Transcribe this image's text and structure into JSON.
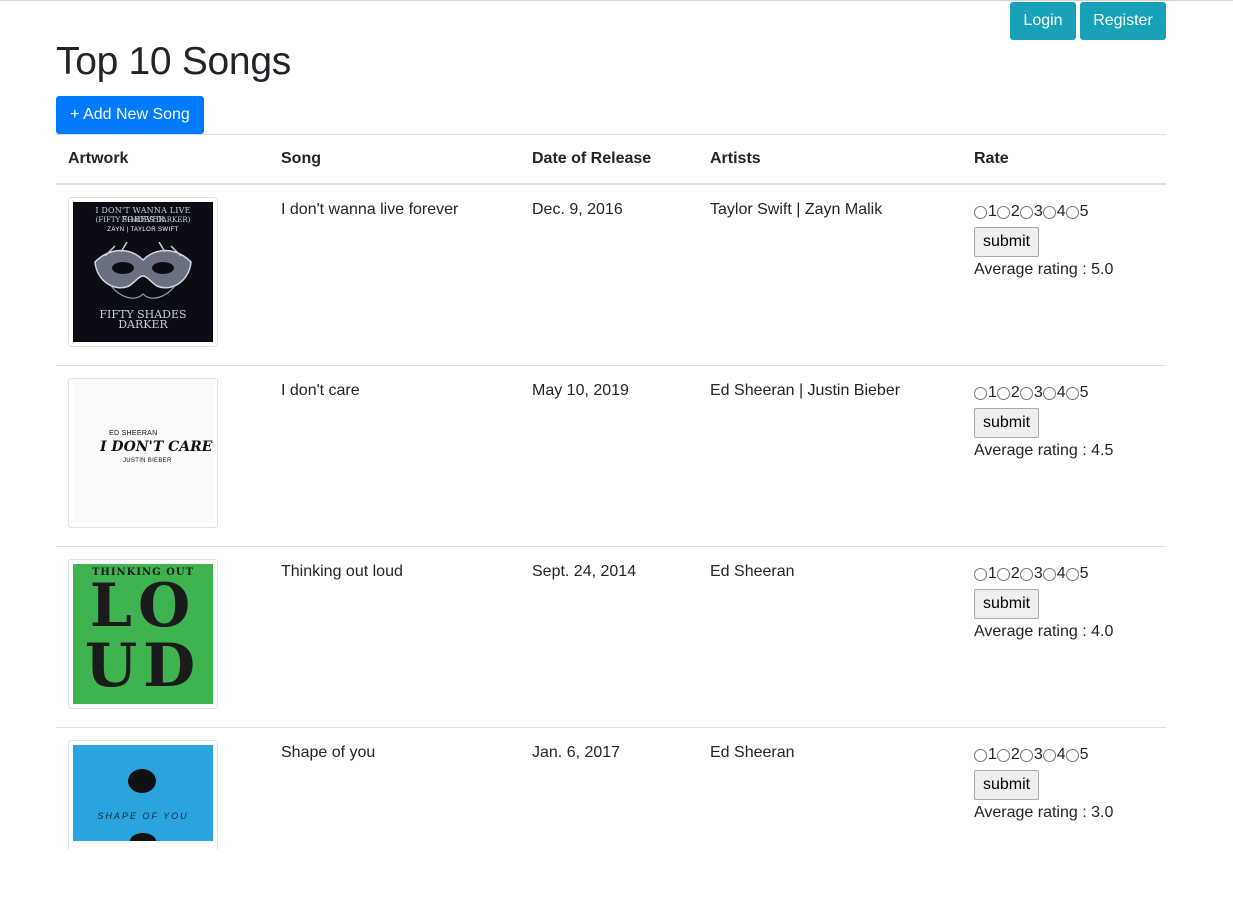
{
  "auth": {
    "login_label": "Login",
    "register_label": "Register"
  },
  "page": {
    "title": "Top 10 Songs",
    "add_button_label": "+ Add New Song"
  },
  "table": {
    "headers": {
      "artwork": "Artwork",
      "song": "Song",
      "date": "Date of Release",
      "artists": "Artists",
      "rate": "Rate"
    },
    "rate_options": [
      "1",
      "2",
      "3",
      "4",
      "5"
    ],
    "submit_label": "submit",
    "rows": [
      {
        "song": "I don't wanna live forever",
        "date": "Dec. 9, 2016",
        "artists": "Taylor Swift | Zayn Malik",
        "average": "Average rating : 5.0",
        "art": {
          "line1": "I DON'T WANNA LIVE FOREVER",
          "line2": "(FIFTY SHADES DARKER)",
          "line3": "ZAYN | TAYLOR SWIFT",
          "line4": "FIFTY SHADES",
          "line5": "DARKER"
        }
      },
      {
        "song": "I don't care",
        "date": "May 10, 2019",
        "artists": "Ed Sheeran | Justin Bieber",
        "average": "Average rating : 4.5",
        "art": {
          "line1": "ED SHEERAN",
          "line2": "I DON'T CARE",
          "line3": "JUSTIN BIEBER"
        }
      },
      {
        "song": "Thinking out loud",
        "date": "Sept. 24, 2014",
        "artists": "Ed Sheeran",
        "average": "Average rating : 4.0",
        "art": {
          "line1": "THINKING OUT",
          "line2": "LO",
          "line3": "UD"
        }
      },
      {
        "song": "Shape of you",
        "date": "Jan. 6, 2017",
        "artists": "Ed Sheeran",
        "average": "Average rating : 3.0",
        "art": {
          "line1": "SHAPE OF YOU"
        }
      }
    ]
  },
  "colors": {
    "info": "#17a2b8",
    "primary": "#007bff",
    "border": "#dee2e6",
    "text": "#212529"
  }
}
